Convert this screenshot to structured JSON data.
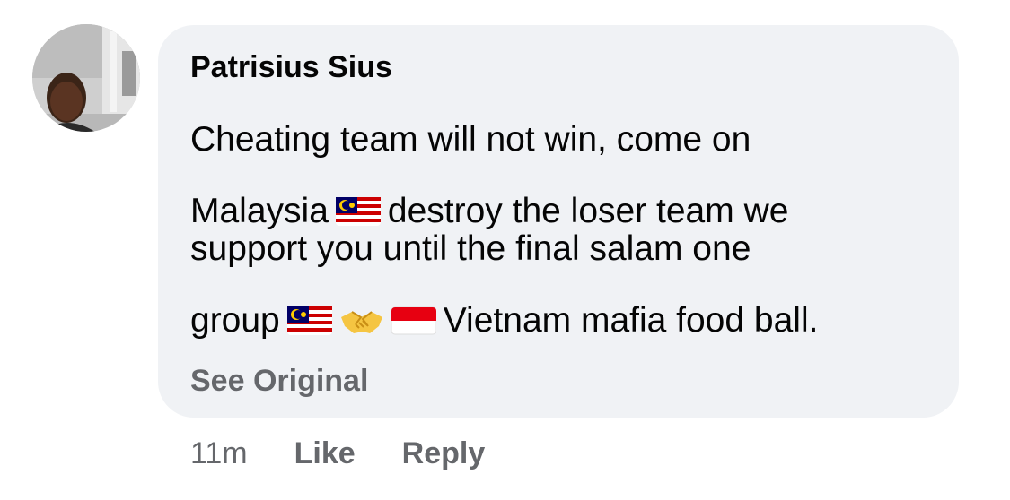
{
  "comment": {
    "author": "Patrisius Sius",
    "lines": [
      [
        "Cheating team will not win, come on"
      ],
      [
        "Malaysia",
        "malaysia-flag-emoji",
        "destroy the loser team we"
      ],
      [
        "support you until the final salam one"
      ],
      [
        "group",
        "malaysia-flag-emoji",
        "handshake-emoji",
        "indonesia-flag-emoji",
        "Vietnam mafia food ball."
      ]
    ],
    "line_1": "Cheating team will not win, come on",
    "line_2_a": "Malaysia",
    "line_2_b": "destroy the loser team we",
    "line_3": "support you until the final salam one",
    "line_4_a": "group",
    "line_4_b": "Vietnam mafia food ball.",
    "see_original": "See Original"
  },
  "actions": {
    "timestamp": "11m",
    "like": "Like",
    "reply": "Reply"
  },
  "colors": {
    "bubble_background": "#f0f2f5",
    "text_primary": "#050505",
    "text_secondary": "#65676b"
  }
}
